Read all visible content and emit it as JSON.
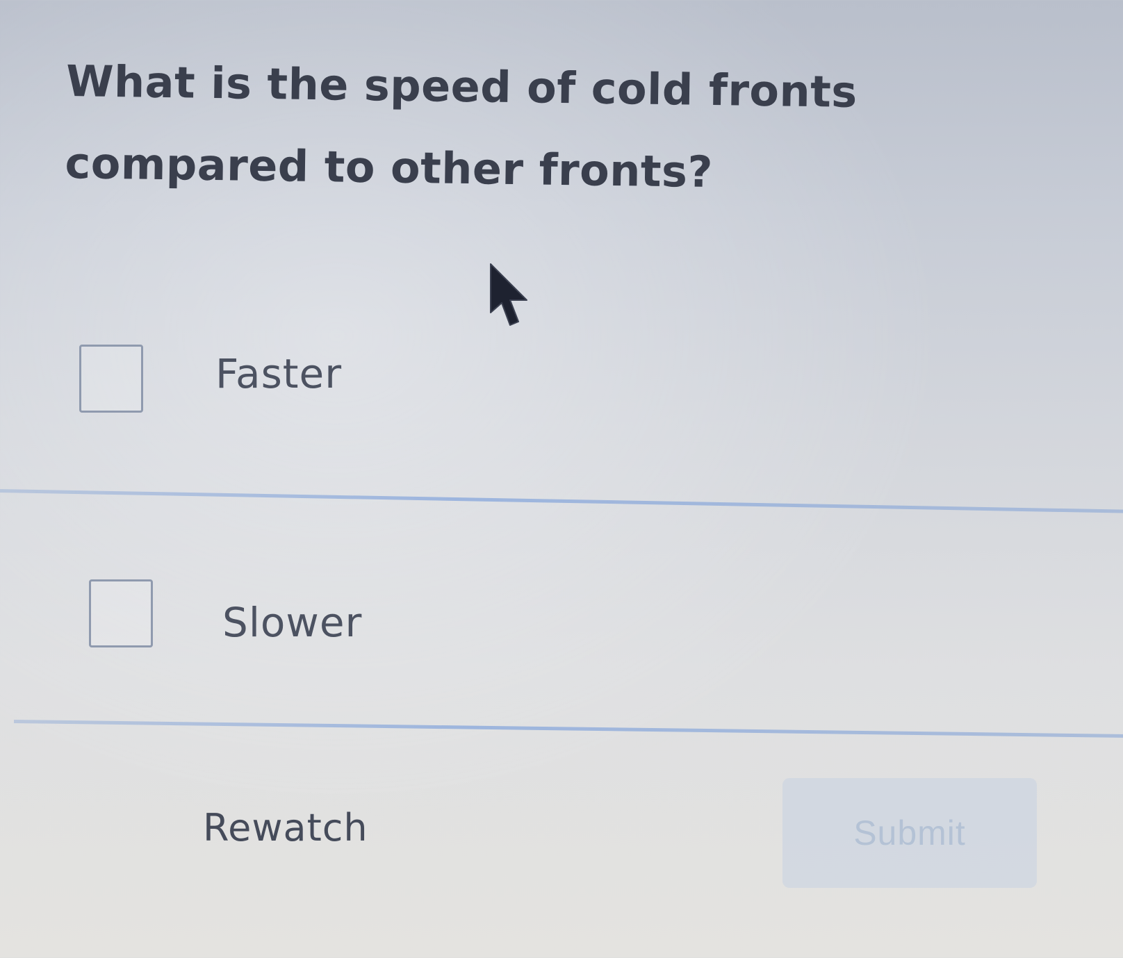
{
  "quiz": {
    "question": "What is the speed of cold fronts compared to other fronts?",
    "options": [
      {
        "label": "Faster",
        "checked": false
      },
      {
        "label": "Slower",
        "checked": false
      }
    ]
  },
  "actions": {
    "rewatch_label": "Rewatch",
    "submit_label": "Submit",
    "submit_enabled": false
  },
  "colors": {
    "question_text": "#3a3f4d",
    "divider": "#8caadc",
    "submit_bg": "#c6d2e2",
    "submit_text": "#b4c2d5"
  },
  "icons": {
    "pointer": "mouse-pointer-icon"
  }
}
